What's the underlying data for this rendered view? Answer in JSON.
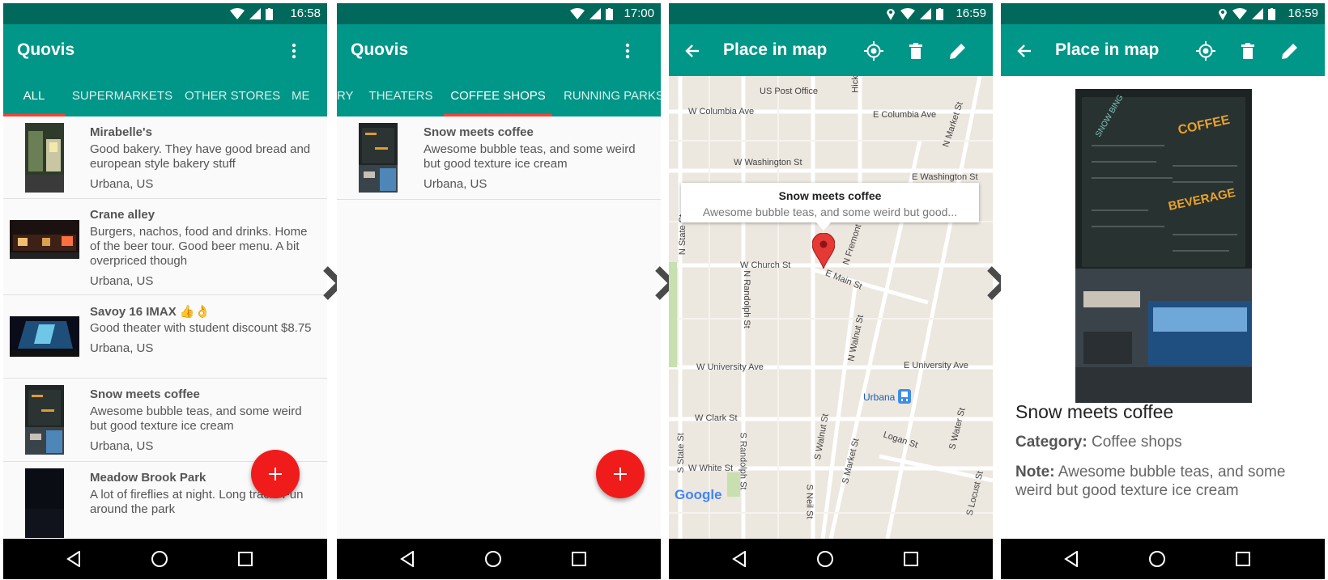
{
  "status": {
    "screen1_time": "16:58",
    "screen2_time": "17:00",
    "screen3_time": "16:59",
    "screen4_time": "16:59"
  },
  "app": {
    "title": "Quovis",
    "tabs_screen1": [
      "ALL",
      "SUPERMARKETS",
      "OTHER STORES",
      "ME"
    ],
    "tabs_screen2": [
      "RY",
      "THEATERS",
      "COFFEE SHOPS",
      "RUNNING PARKS"
    ],
    "accent_color": "#009688",
    "status_color": "#00695c",
    "indicator_color": "#f44336",
    "fab_color": "#f01c1c"
  },
  "places": [
    {
      "name": "Mirabelle's",
      "note": "Good bakery. They have good bread and european style bakery stuff",
      "location": "Urbana, US"
    },
    {
      "name": "Crane alley",
      "note": "Burgers, nachos, food and drinks. Home of the beer tour. Good beer menu. A bit overpriced though",
      "location": "Urbana, US"
    },
    {
      "name": "Savoy 16 IMAX 👍👌",
      "note": "Good theater with student discount $8.75",
      "location": "Urbana, US"
    },
    {
      "name": "Snow meets coffee",
      "note": "Awesome bubble teas, and some weird but good texture ice cream",
      "location": "Urbana, US"
    },
    {
      "name": "Meadow Brook Park",
      "note": "A lot of fireflies at night. Long track. Fun around the park",
      "location": ""
    }
  ],
  "coffee_list": [
    {
      "name": "Snow meets coffee",
      "note": "Awesome bubble teas, and some weird but good texture ice cream",
      "location": "Urbana, US"
    }
  ],
  "map_screen": {
    "title": "Place in map",
    "info_title": "Snow meets coffee",
    "info_snippet": "Awesome bubble teas, and some weird but good...",
    "streets": {
      "us_post_office": "US Post Office",
      "w_columbia": "W Columbia Ave",
      "e_columbia": "E Columbia Ave",
      "w_washington": "W Washington St",
      "e_washington": "E Washington St",
      "n_market": "N Market St",
      "hickory": "Hick",
      "n_state": "N State St",
      "w_church": "W Church St",
      "e_main": "E Main St",
      "n_fremont": "N Fremont St",
      "n_randolph": "N Randolph St",
      "n_walnut": "N Walnut St",
      "w_university": "W University Ave",
      "e_university": "E University Ave",
      "urbana": "Urbana",
      "w_clark": "W Clark St",
      "s_walnut": "S Walnut St",
      "logan": "Logan St",
      "s_water": "S Water St",
      "s_state": "S State St",
      "s_randolph": "S Randolph St",
      "s_market": "S Market St",
      "w_white": "W White St",
      "s_neil": "S Neil St",
      "s_locust": "S Locust St"
    },
    "google_logo": "Google"
  },
  "detail_screen": {
    "title": "Place in map",
    "place_name": "Snow meets coffee",
    "category_label": "Category:",
    "category_value": "Coffee shops",
    "note_label": "Note:",
    "note_value": "Awesome bubble teas, and some weird but good texture ice cream",
    "photo_sign_1": "COFFEE",
    "photo_sign_2": "BEVERAGE",
    "photo_sign_3": "SNOW BING"
  },
  "icons": {
    "overflow": "more-vert-icon",
    "back": "arrow-back-icon",
    "locate": "my-location-icon",
    "delete": "delete-icon",
    "edit": "edit-icon",
    "add": "add-icon",
    "nav_back": "nav-back-icon",
    "nav_home": "nav-home-icon",
    "nav_recents": "nav-recents-icon",
    "next": "chevron-right-icon"
  }
}
